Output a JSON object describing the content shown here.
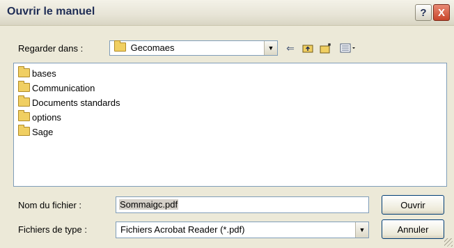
{
  "window": {
    "title": "Ouvrir le manuel",
    "help_glyph": "?",
    "close_glyph": "X"
  },
  "look_in": {
    "label": "Regarder dans :",
    "value": "Gecomaes",
    "icon": "folder-icon"
  },
  "toolbar": {
    "back_icon": "arrow-left-icon",
    "up_icon": "folder-up-icon",
    "new_folder_icon": "new-folder-icon",
    "views_icon": "view-menu-icon"
  },
  "files": [
    {
      "name": "bases"
    },
    {
      "name": "Communication"
    },
    {
      "name": "Documents standards"
    },
    {
      "name": "options"
    },
    {
      "name": "Sage"
    }
  ],
  "filename": {
    "label": "Nom du fichier :",
    "value": "Sommaigc.pdf"
  },
  "filetype": {
    "label": "Fichiers de type :",
    "value": "Fichiers Acrobat Reader (*.pdf)"
  },
  "buttons": {
    "open": "Ouvrir",
    "cancel": "Annuler"
  }
}
